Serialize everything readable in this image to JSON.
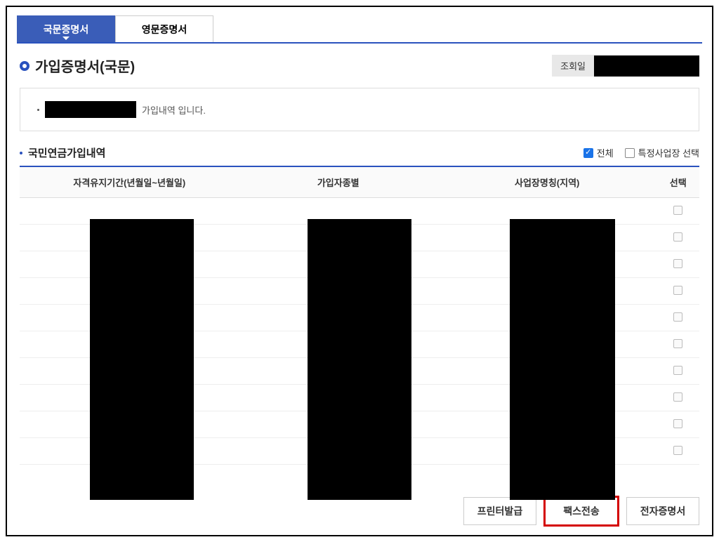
{
  "tabs": {
    "korean": "국문증명서",
    "english": "영문증명서"
  },
  "page_title": "가입증명서(국문)",
  "lookup_label": "조회일",
  "info_suffix": "가입내역 입니다.",
  "section_title": "국민연금가입내역",
  "filters": {
    "all": "전체",
    "specific": "특정사업장 선택"
  },
  "table": {
    "headers": {
      "period": "자격유지기간(년월일~년월일)",
      "type": "가입자종별",
      "business": "사업장명칭(지역)",
      "select": "선택"
    },
    "row_count": 10
  },
  "actions": {
    "print": "프린터발급",
    "fax": "팩스전송",
    "ecert": "전자증명서"
  }
}
